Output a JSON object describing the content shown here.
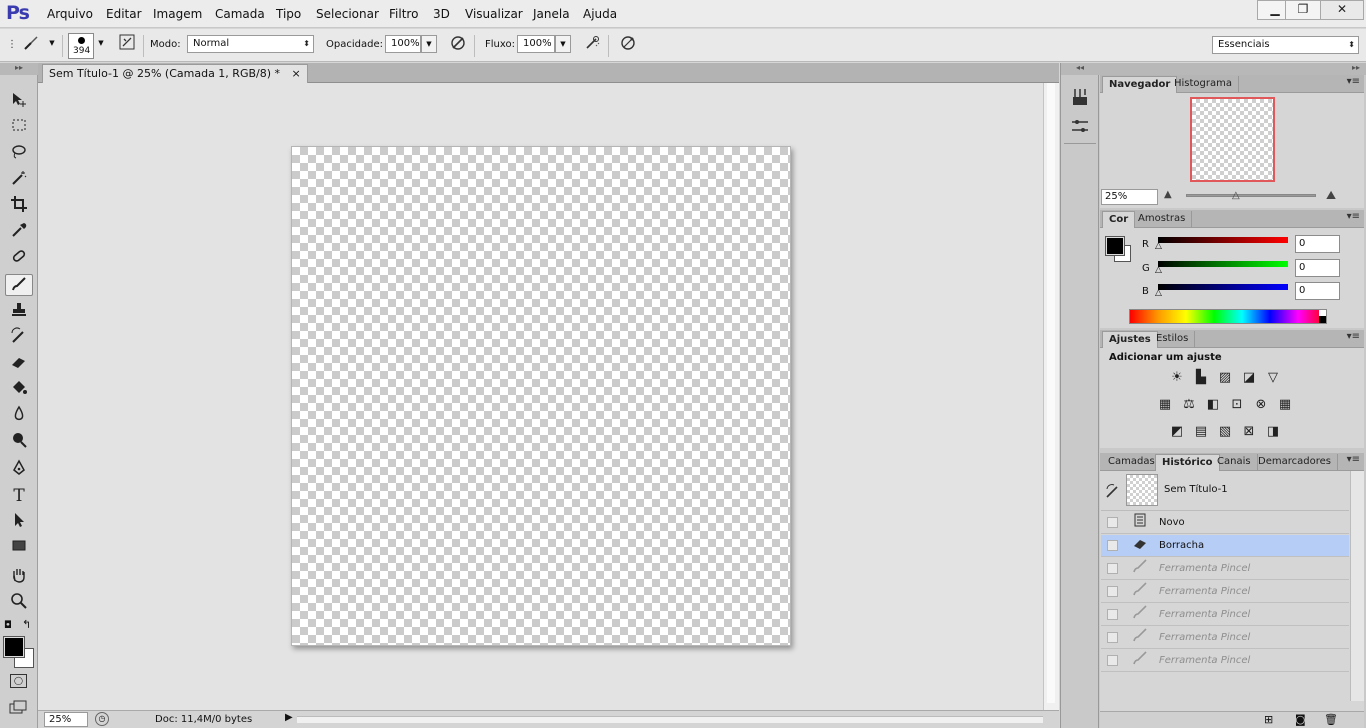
{
  "app": {
    "logo": "Ps"
  },
  "menu": [
    "Arquivo",
    "Editar",
    "Imagem",
    "Camada",
    "Tipo",
    "Selecionar",
    "Filtro",
    "3D",
    "Visualizar",
    "Janela",
    "Ajuda"
  ],
  "window_controls": {
    "minimize": "▁",
    "restore": "❐",
    "close": "✕"
  },
  "options": {
    "brush_size": "394",
    "mode_label": "Modo:",
    "mode_value": "Normal",
    "opacity_label": "Opacidade:",
    "opacity_value": "100%",
    "flow_label": "Fluxo:",
    "flow_value": "100%",
    "workspace": "Essenciais"
  },
  "tools": [
    "move-icon",
    "marquee-icon",
    "lasso-icon",
    "magic-wand-icon",
    "crop-icon",
    "eyedropper-icon",
    "healing-brush-icon",
    "brush-icon",
    "clone-stamp-icon",
    "history-brush-icon",
    "eraser-icon",
    "paint-bucket-icon",
    "blur-icon",
    "dodge-icon",
    "pen-icon",
    "type-icon",
    "path-selection-icon",
    "rectangle-icon",
    "hand-icon",
    "zoom-icon"
  ],
  "document": {
    "tab_title": "Sem Título-1 @ 25% (Camada 1, RGB/8) *",
    "tab_close": "×",
    "zoom": "25%",
    "doc_info": "Doc: 11,4M/0 bytes"
  },
  "panels": {
    "navigator": {
      "tabs": [
        "Navegador",
        "Histograma"
      ],
      "zoom": "25%"
    },
    "color": {
      "tabs": [
        "Cor",
        "Amostras"
      ],
      "r_label": "R",
      "g_label": "G",
      "b_label": "B",
      "r": "0",
      "g": "0",
      "b": "0",
      "foreground": "#000000",
      "background": "#ffffff"
    },
    "adjustments": {
      "tabs": [
        "Ajustes",
        "Estilos"
      ],
      "heading": "Adicionar um ajuste"
    },
    "history": {
      "tabs": [
        "Camadas",
        "Histórico",
        "Canais",
        "Demarcadores"
      ],
      "snapshot": "Sem Título-1",
      "steps": [
        {
          "label": "Novo",
          "state": "normal",
          "icon": "new-doc-icon"
        },
        {
          "label": "Borracha",
          "state": "selected",
          "icon": "eraser-icon"
        },
        {
          "label": "Ferramenta Pincel",
          "state": "dim",
          "icon": "brush-icon"
        },
        {
          "label": "Ferramenta Pincel",
          "state": "dim",
          "icon": "brush-icon"
        },
        {
          "label": "Ferramenta Pincel",
          "state": "dim",
          "icon": "brush-icon"
        },
        {
          "label": "Ferramenta Pincel",
          "state": "dim",
          "icon": "brush-icon"
        },
        {
          "label": "Ferramenta Pincel",
          "state": "dim",
          "icon": "brush-icon"
        }
      ]
    }
  },
  "colors": {
    "accent_selected": "#b6cdf5",
    "navigator_frame": "#e0585a"
  }
}
